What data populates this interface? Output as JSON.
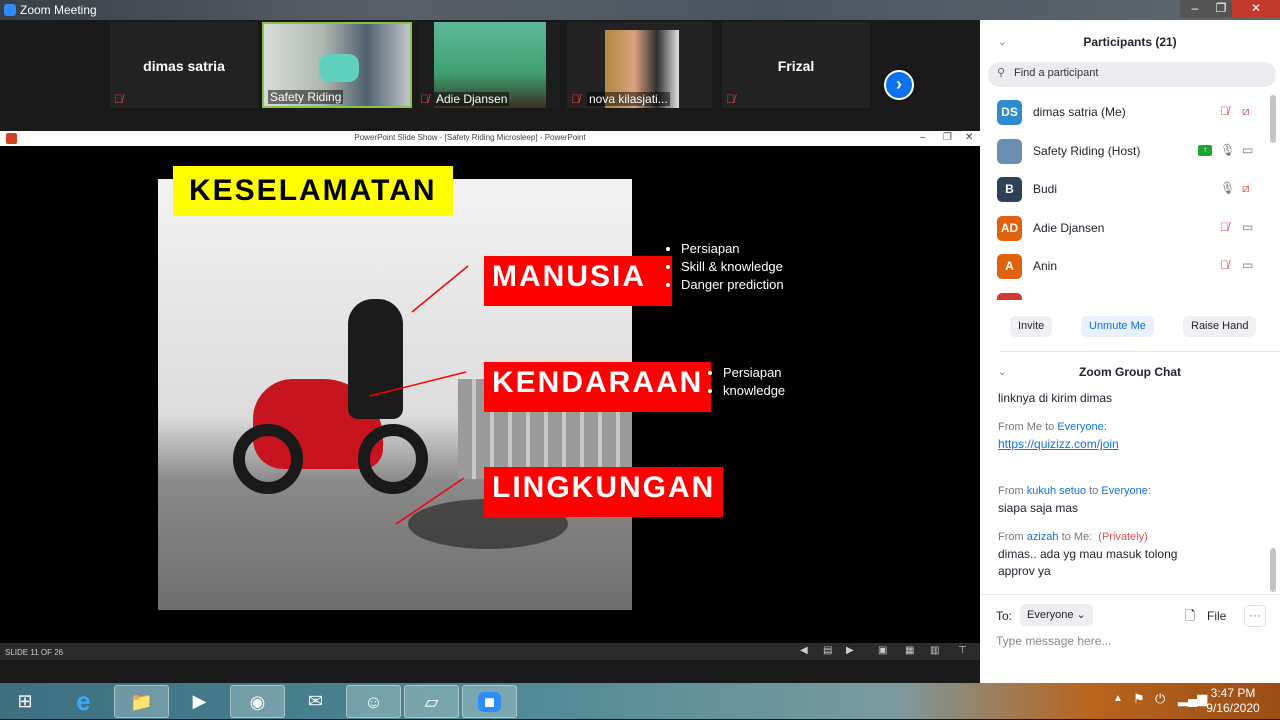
{
  "window": {
    "title": "Zoom Meeting",
    "controls": [
      "–",
      "❐",
      "✕"
    ]
  },
  "strip": {
    "tiles": [
      {
        "name": "dimas satria",
        "type": "name",
        "muted": true
      },
      {
        "name": "Safety Riding",
        "type": "video",
        "muted": false,
        "active": true
      },
      {
        "name": "Adie Djansen",
        "type": "video",
        "muted": true
      },
      {
        "name": "nova kilasjati...",
        "type": "video",
        "muted": true
      },
      {
        "name": "Frizal",
        "type": "name",
        "muted": true
      }
    ],
    "next_icon": "chevron-right-icon"
  },
  "ppt": {
    "title": "PowerPoint Slide Show - [Safety Riding Microsleep] - PowerPoint",
    "controls": [
      "–",
      "❐",
      "✕"
    ],
    "status": "SLIDE 11 OF 26"
  },
  "slide": {
    "title": "KESELAMATAN",
    "sections": [
      {
        "label": "MANUSIA",
        "bullets": [
          "Persiapan",
          "Skill & knowledge",
          "Danger prediction"
        ]
      },
      {
        "label": "KENDARAAN",
        "bullets": [
          "Persiapan",
          "knowledge"
        ]
      },
      {
        "label": "LINGKUNGAN",
        "bullets": []
      }
    ],
    "colors": {
      "title_bg": "#ffff00",
      "label_bg": "#ff0000"
    }
  },
  "participants": {
    "title": "Participants (21)",
    "search_placeholder": "Find a participant",
    "list": [
      {
        "initials": "DS",
        "name": "dimas satria (Me)",
        "color": "#2e8bcf",
        "mic": "muted",
        "video": "off"
      },
      {
        "initials": "",
        "name": "Safety Riding (Host)",
        "color": "#6a8fb0",
        "mic": "on",
        "video": "on",
        "sharing": true
      },
      {
        "initials": "B",
        "name": "Budi",
        "color": "#2f4156",
        "mic": "on",
        "video": "off"
      },
      {
        "initials": "AD",
        "name": "Adie Djansen",
        "color": "#e0620d",
        "mic": "muted",
        "video": "on"
      },
      {
        "initials": "A",
        "name": "Anin",
        "color": "#e0620d",
        "mic": "muted",
        "video": "on"
      }
    ],
    "buttons": {
      "invite": "Invite",
      "unmute": "Unmute Me",
      "raise": "Raise Hand"
    }
  },
  "chat": {
    "title": "Zoom Group Chat",
    "first_line": "linknya di kirim dimas",
    "messages": [
      {
        "from": "Me",
        "to": "Everyone",
        "private": "",
        "text": "https://quizizz.com/join",
        "link": true
      },
      {
        "from": "kukuh setuo",
        "to": "Everyone",
        "private": "",
        "text": "siapa saja mas"
      },
      {
        "from": "azizah",
        "to": "Me",
        "private": "(Privately)",
        "text": "dimas.. ada yg mau masuk tolong approv ya"
      }
    ],
    "to_label": "To:",
    "to_value": "Everyone",
    "file_label": "File",
    "more": "···",
    "input_placeholder": "Type message here..."
  },
  "taskbar": {
    "time": "3:47 PM",
    "date": "9/16/2020"
  }
}
